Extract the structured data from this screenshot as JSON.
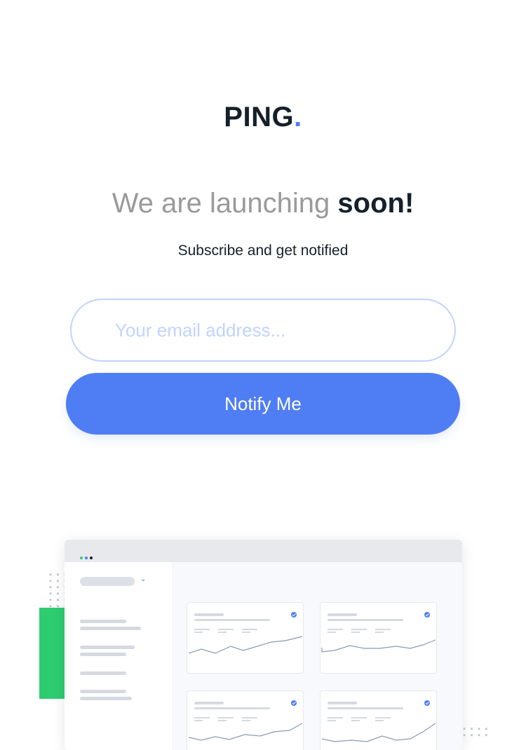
{
  "brand": {
    "name": "PING",
    "dot": "."
  },
  "hero": {
    "headline_light": "We are launching ",
    "headline_bold": "soon!",
    "subtitle": "Subscribe and get notified"
  },
  "form": {
    "email_placeholder": "Your email address...",
    "email_value": "",
    "submit_label": "Notify Me"
  },
  "colors": {
    "accent": "#4f7df3",
    "text": "#15202a",
    "muted": "#9a9a9a",
    "input_border": "#c2d3ff",
    "green": "#2ecc71"
  },
  "illustration": {
    "icon": "dashboard-mockup-illustration",
    "window_dots": [
      "#2ecc71",
      "#4f7df3",
      "#15202a"
    ]
  }
}
